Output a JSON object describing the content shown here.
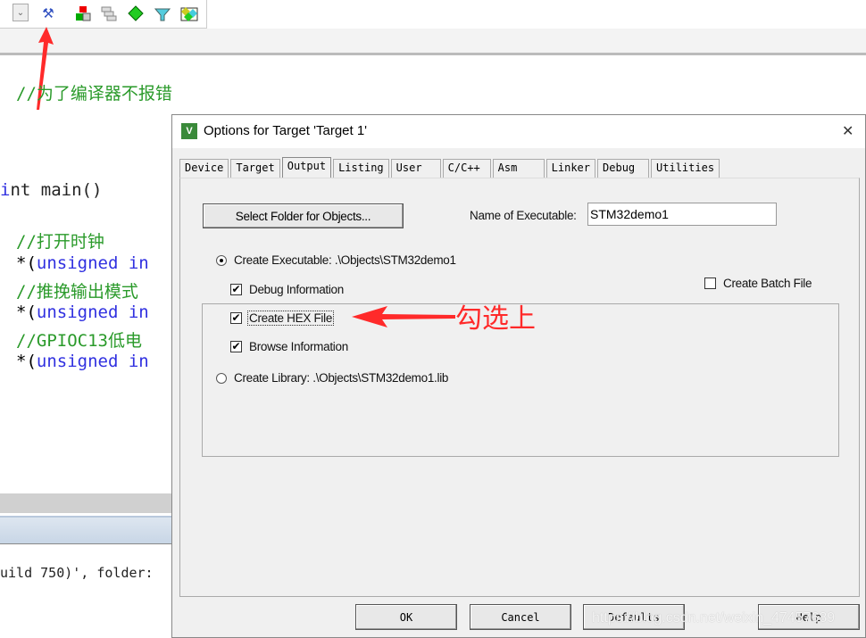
{
  "toolbar": {
    "icons": [
      "dropdown-icon",
      "manage-run-time-environment-icon",
      "select-packs-icon",
      "layers-icon",
      "pack-installer-icon",
      "filter-icon",
      "components-icon"
    ]
  },
  "editor": {
    "lines": [
      {
        "text": "//为了编译器不报错",
        "type": "comment"
      },
      {
        "text": "nt main()",
        "type": "code"
      },
      {
        "text": "//打开时钟",
        "type": "comment"
      },
      {
        "pre": "*(",
        "text": "unsigned in",
        "type": "keyword"
      },
      {
        "text": "//推挽输出模式",
        "type": "comment"
      },
      {
        "pre": "*(",
        "text": "unsigned in",
        "type": "keyword"
      },
      {
        "text": "//GPIOC13低电",
        "type": "comment"
      },
      {
        "pre": "*(",
        "text": "unsigned in",
        "type": "keyword"
      }
    ],
    "output_line": "uild 750)', folder:"
  },
  "dialog": {
    "title": "Options for Target 'Target 1'",
    "close": "✕",
    "tabs": [
      "Device",
      "Target",
      "Output",
      "Listing",
      "User",
      "C/C++",
      "Asm",
      "Linker",
      "Debug",
      "Utilities"
    ],
    "active_tab": "Output",
    "select_folder_button": "Select Folder for Objects...",
    "name_of_executable_label": "Name of Executable:",
    "name_of_executable_value": "STM32demo1",
    "create_executable": {
      "label": "Create Executable:  .\\Objects\\STM32demo1",
      "selected": true
    },
    "debug_information": {
      "label": "Debug Information",
      "checked": true
    },
    "create_hex_file": {
      "label": "Create HEX File",
      "checked": true
    },
    "browse_information": {
      "label": "Browse Information",
      "checked": true
    },
    "create_library": {
      "label": "Create Library:  .\\Objects\\STM32demo1.lib",
      "selected": false
    },
    "create_batch_file": {
      "label": "Create Batch File",
      "checked": false
    },
    "buttons": {
      "ok": "OK",
      "cancel": "Cancel",
      "defaults": "Defaults",
      "help": "Help"
    }
  },
  "annotation": {
    "text": "勾选上",
    "color": "#ff2a2a"
  },
  "watermark": "https://blog.csdn.net/weixin_47457689",
  "colors": {
    "comment": "#2a9a2a",
    "keyword": "#3030e0",
    "arrow": "#ff2a2a"
  }
}
